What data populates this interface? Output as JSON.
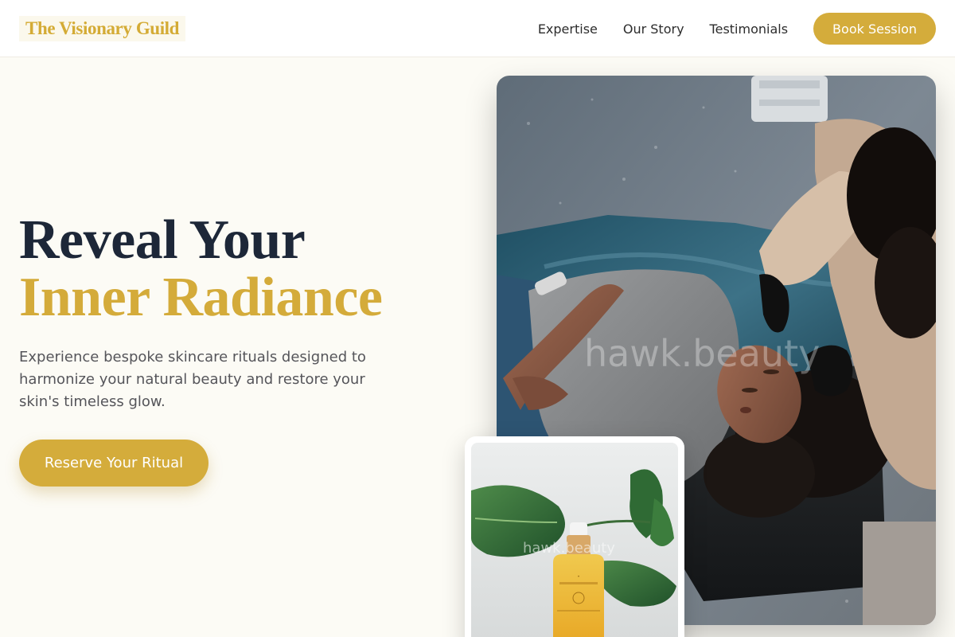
{
  "brand": {
    "name": "The Visionary Guild"
  },
  "nav": {
    "links": [
      "Expertise",
      "Our Story",
      "Testimonials"
    ],
    "cta_label": "Book Session"
  },
  "hero": {
    "title_line1": "Reveal Your",
    "title_line2": "Inner Radiance",
    "description": "Experience bespoke skincare rituals designed to harmonize your natural beauty and restore your skin's timeless glow.",
    "cta_label": "Reserve Your Ritual"
  },
  "images": {
    "main_watermark": "hawk.beauty",
    "product_watermark": "hawk.beauty",
    "main_alt": "facial-treatment-photo",
    "product_alt": "serum-bottle-photo"
  },
  "colors": {
    "accent": "#d4ac3b",
    "heading_dark": "#1d2738",
    "background": "#fcfbf5"
  }
}
